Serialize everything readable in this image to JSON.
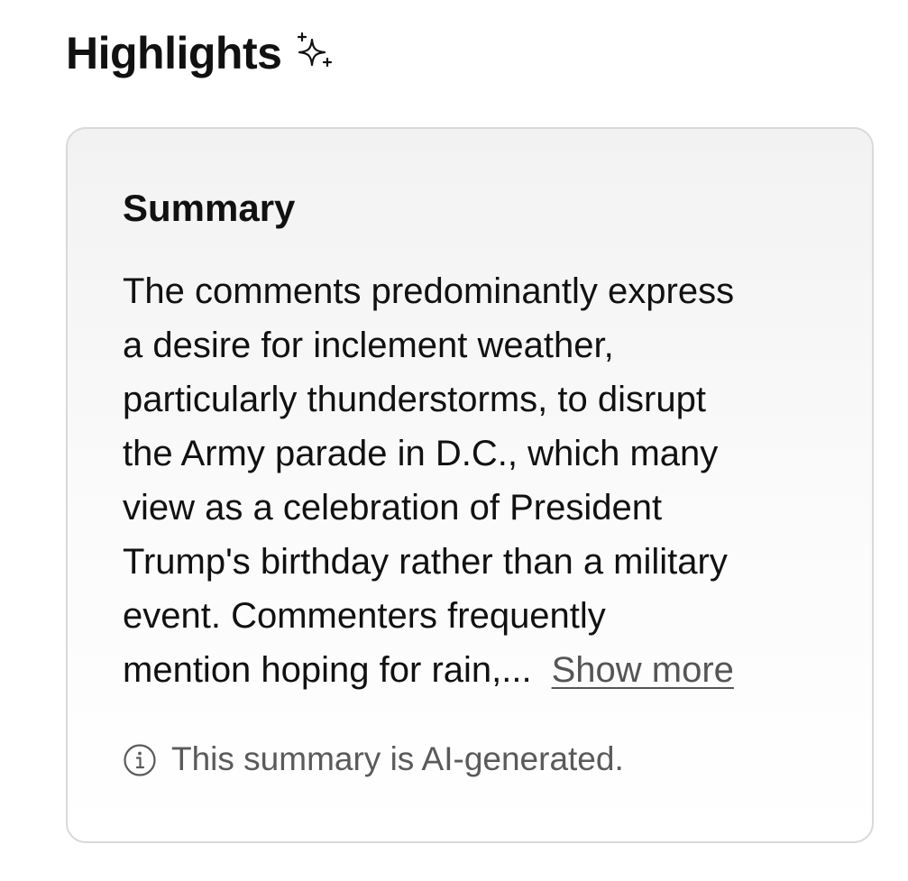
{
  "header": {
    "title": "Highlights",
    "icon": "sparkle-icon"
  },
  "summary_card": {
    "title": "Summary",
    "lines": [
      "The comments predominantly express",
      "a desire for inclement weather,",
      "particularly thunderstorms, to disrupt",
      "the Army parade in D.C., which many",
      "view as a celebration of President",
      "Trump's birthday rather than a military",
      "event. Commenters frequently",
      "mention hoping for rain,..."
    ],
    "show_more_label": "Show more",
    "disclaimer": "This summary is AI-generated.",
    "disclaimer_icon": "info-icon"
  },
  "colors": {
    "text": "#111111",
    "muted": "#555555",
    "card_border": "#d9d9d9",
    "card_background": "#f2f2f2"
  }
}
